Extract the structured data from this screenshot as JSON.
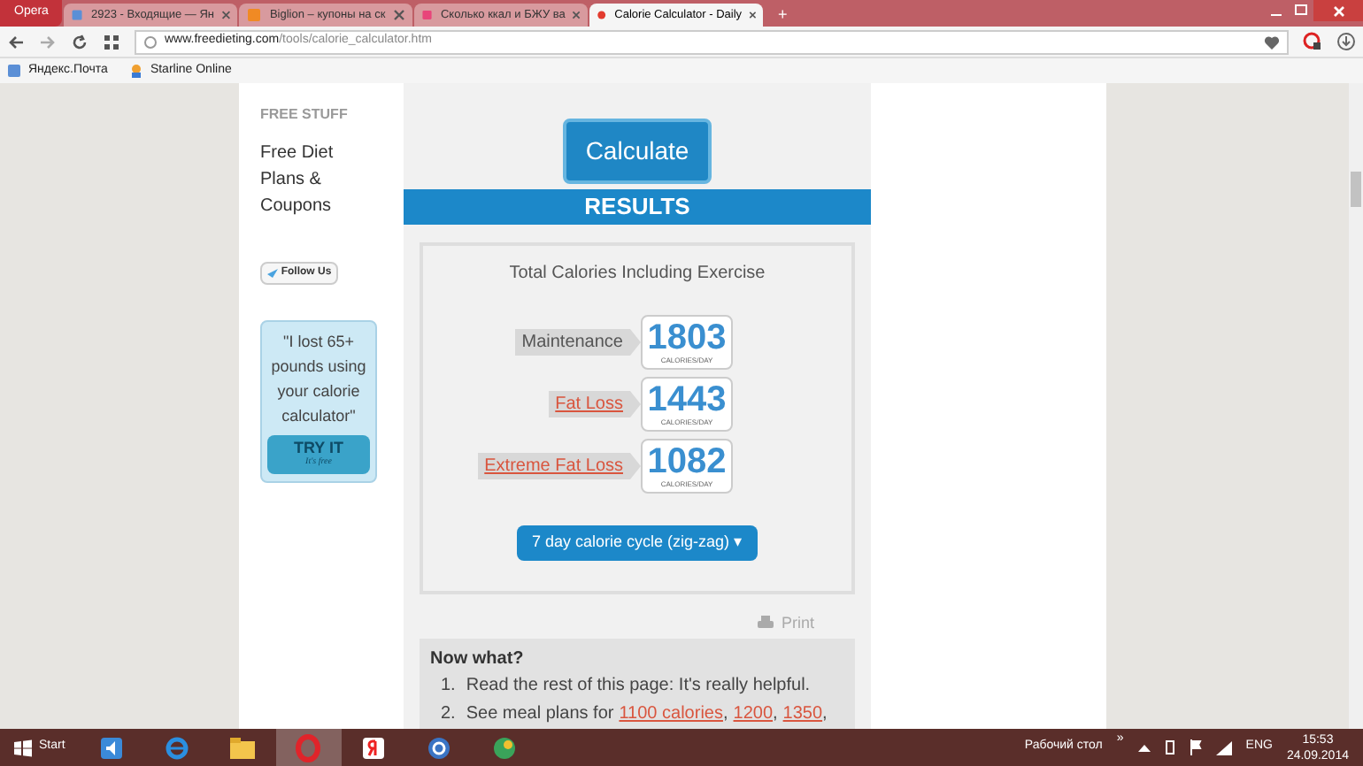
{
  "browser": {
    "menu_label": "Opera",
    "tabs": [
      {
        "title": "2923 - Входящие — Ян",
        "selected": false
      },
      {
        "title": "Biglion – купоны на ск",
        "selected": false
      },
      {
        "title": "Сколько ккал и БЖУ ва",
        "selected": false
      },
      {
        "title": "Calorie Calculator - Daily",
        "selected": true
      }
    ],
    "new_tab": "+",
    "address": {
      "domain": "www.freedieting.com",
      "path": "/tools/calorie_calculator.htm"
    },
    "bookmarks": [
      "Яндекс.Почта",
      "Starline Online"
    ]
  },
  "sidebar": {
    "heading": "FREE STUFF",
    "link": "Free Diet Plans & Coupons",
    "follow_button": "Follow Us",
    "promo": {
      "quote": "\"I lost 65+ pounds using your calorie calculator\"",
      "button": "TRY IT",
      "button_note": "It's free"
    }
  },
  "calculate_button": "Calculate",
  "results": {
    "heading": "RESULTS",
    "title": "Total Calories Including Exercise",
    "rows": [
      {
        "label": "Maintenance",
        "kind": "plain",
        "value": "1803",
        "unit": "CALORIES/DAY"
      },
      {
        "label": "Fat Loss",
        "kind": "link",
        "value": "1443",
        "unit": "CALORIES/DAY"
      },
      {
        "label": "Extreme Fat Loss",
        "kind": "link",
        "value": "1082",
        "unit": "CALORIES/DAY"
      }
    ],
    "cycle_button": "7 day calorie cycle (zig-zag) ▾"
  },
  "print_link": "Print",
  "now_what": {
    "heading": "Now what?",
    "items": [
      {
        "number": "1.",
        "parts": [
          {
            "kind": "text",
            "text": "Read the rest of this page: It's really helpful."
          }
        ]
      },
      {
        "number": "2.",
        "parts": [
          {
            "kind": "text",
            "text": "See meal plans for"
          },
          {
            "kind": "link",
            "text": "1100 calories"
          },
          {
            "kind": "text",
            "text": ","
          },
          {
            "kind": "link",
            "text": "1200"
          },
          {
            "kind": "text",
            "text": ","
          },
          {
            "kind": "link",
            "text": "1350"
          },
          {
            "kind": "text",
            "text": ","
          }
        ]
      }
    ]
  },
  "taskbar": {
    "start": "Start",
    "apps": [
      {
        "selected": false
      },
      {
        "selected": false
      },
      {
        "selected": false
      },
      {
        "selected": true
      },
      {
        "selected": false
      },
      {
        "selected": false
      },
      {
        "selected": false
      }
    ],
    "desktop_label": "Рабочий стол",
    "chevron": "»",
    "language": "ENG",
    "time": "15:53",
    "date": "24.09.2014"
  }
}
